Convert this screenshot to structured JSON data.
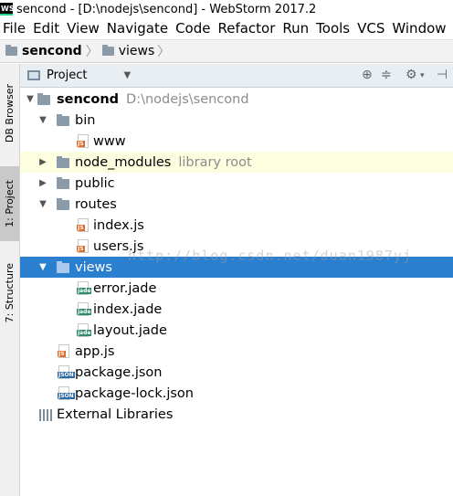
{
  "window": {
    "logo": "WS",
    "title": "sencond - [D:\\nodejs\\sencond] - WebStorm 2017.2"
  },
  "menu": [
    "File",
    "Edit",
    "View",
    "Navigate",
    "Code",
    "Refactor",
    "Run",
    "Tools",
    "VCS",
    "Window"
  ],
  "breadcrumb": [
    "sencond",
    "views"
  ],
  "side_tabs": {
    "db_browser": "DB Browser",
    "project": "1: Project",
    "structure": "7: Structure"
  },
  "project_panel": {
    "title": "Project",
    "dropdown_icon": "chevron-down-icon",
    "buttons": [
      "locate-icon",
      "collapse-icon",
      "settings-icon",
      "hide-icon"
    ]
  },
  "tree": {
    "root_name": "sencond",
    "root_path": "D:\\nodejs\\sencond",
    "bin": "bin",
    "www": "www",
    "node_modules": "node_modules",
    "node_modules_hint": "library root",
    "public": "public",
    "routes": "routes",
    "index_js": "index.js",
    "users_js": "users.js",
    "views": "views",
    "error_jade": "error.jade",
    "index_jade": "index.jade",
    "layout_jade": "layout.jade",
    "app_js": "app.js",
    "package_json": "package.json",
    "package_lock_json": "package-lock.json",
    "external_libraries": "External Libraries"
  },
  "watermark": "http://blog.csdn.net/duan1987yj",
  "colors": {
    "selection": "#2b7fcf",
    "header": "#e9eef3",
    "hover_row": "#fdfde0"
  }
}
